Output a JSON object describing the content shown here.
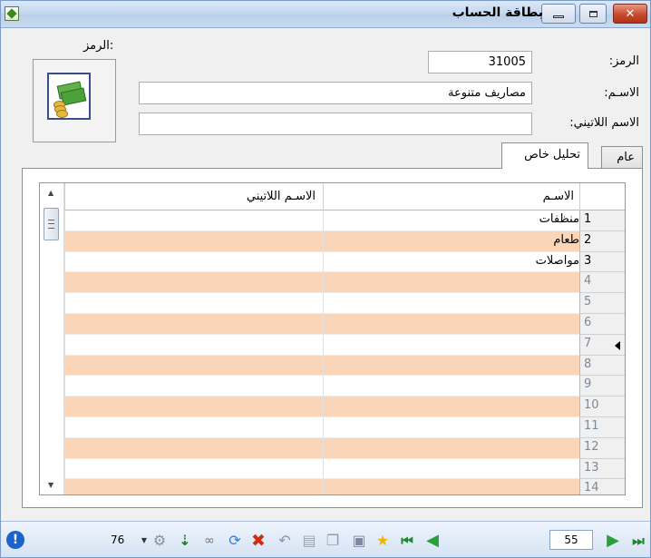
{
  "window": {
    "title": "بطاقة الحساب",
    "close_glyph": "✕"
  },
  "icon_box": {
    "label": "الرمز:",
    "icon": "money-icon"
  },
  "form": {
    "code_label": "الرمز:",
    "code_value": "31005",
    "name_label": "الاسـم:",
    "name_value": "مصاريف متنوعة",
    "latin_label": "الاسم اللاتيني:",
    "latin_value": ""
  },
  "tabs": [
    {
      "label": "عام",
      "active": false
    },
    {
      "label": "تحليل خاص",
      "active": true
    }
  ],
  "grid": {
    "columns": {
      "latin": "الاسـم اللاتيني",
      "name": "الاسـم"
    },
    "rows": [
      {
        "num": "1",
        "name": "منظفات",
        "latin": ""
      },
      {
        "num": "2",
        "name": "طعام",
        "latin": ""
      },
      {
        "num": "3",
        "name": "مواصلات",
        "latin": ""
      },
      {
        "num": "4",
        "name": "",
        "latin": ""
      },
      {
        "num": "5",
        "name": "",
        "latin": ""
      },
      {
        "num": "6",
        "name": "",
        "latin": ""
      },
      {
        "num": "7",
        "name": "",
        "latin": ""
      },
      {
        "num": "8",
        "name": "",
        "latin": ""
      },
      {
        "num": "9",
        "name": "",
        "latin": ""
      },
      {
        "num": "10",
        "name": "",
        "latin": ""
      },
      {
        "num": "11",
        "name": "",
        "latin": ""
      },
      {
        "num": "12",
        "name": "",
        "latin": ""
      },
      {
        "num": "13",
        "name": "",
        "latin": ""
      },
      {
        "num": "14",
        "name": "",
        "latin": ""
      }
    ],
    "current_row": "7",
    "row_alt_color": "#fbd5b8"
  },
  "toolbar": {
    "record_count": "76",
    "page_value": "55",
    "icons": [
      "info-icon",
      "settings-icon",
      "sort-icon",
      "view-icon",
      "refresh-icon",
      "delete-icon",
      "undo-icon",
      "paste-icon",
      "copy-icon",
      "save-icon",
      "favorite-icon",
      "first-record-icon",
      "previous-record-icon",
      "next-record-icon",
      "last-record-icon"
    ]
  }
}
